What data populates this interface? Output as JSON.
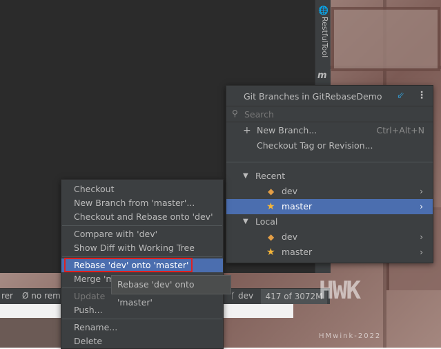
{
  "side_tool": {
    "label": "RestfulTool"
  },
  "status_bar": {
    "left_text": "rer",
    "remote_text": "Ø no rem",
    "branch_text": "dev",
    "memory_text": "417 of 3072M"
  },
  "watermark": {
    "logo": "HWK",
    "signature": "HMwink-2022"
  },
  "git_popup": {
    "title": "Git Branches in GitRebaseDemo",
    "search_placeholder": "Search",
    "actions": [
      {
        "label": "New Branch...",
        "shortcut": "Ctrl+Alt+N"
      },
      {
        "label": "Checkout Tag or Revision..."
      }
    ],
    "groups": [
      {
        "name": "Recent",
        "branches": [
          {
            "name": "dev",
            "icon": "tag-icon",
            "selected": false
          },
          {
            "name": "master",
            "icon": "star-icon",
            "selected": true
          }
        ]
      },
      {
        "name": "Local",
        "branches": [
          {
            "name": "dev",
            "icon": "tag-icon",
            "selected": false
          },
          {
            "name": "master",
            "icon": "star-icon",
            "selected": false
          }
        ]
      }
    ]
  },
  "context_menu": {
    "items": [
      {
        "label": "Checkout"
      },
      {
        "label": "New Branch from 'master'..."
      },
      {
        "label": "Checkout and Rebase onto 'dev'"
      },
      {
        "label": "Compare with 'dev'"
      },
      {
        "label": "Show Diff with Working Tree"
      },
      {
        "label": "Rebase 'dev' onto 'master'",
        "selected": true
      },
      {
        "label": "Merge 'master' into 'dev'"
      },
      {
        "label": "Update",
        "disabled": true
      },
      {
        "label": "Push..."
      },
      {
        "label": "Rename..."
      },
      {
        "label": "Delete"
      }
    ]
  },
  "tooltip": {
    "text": "Rebase 'dev' onto 'master'"
  },
  "colors": {
    "selection": "#4b6eaf",
    "highlight_box": "#e02020",
    "tag": "#e39e46",
    "star": "#f3b53a"
  }
}
